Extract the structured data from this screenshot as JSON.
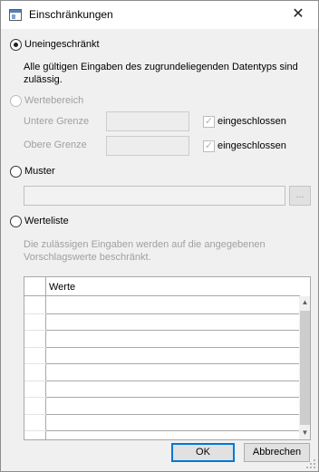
{
  "window": {
    "title": "Einschränkungen",
    "close_glyph": "✕",
    "icon": "window-app-icon"
  },
  "options": {
    "unrestricted": {
      "label": "Uneingeschränkt",
      "selected": true,
      "description": "Alle gültigen Eingaben des zugrundeliegenden Datentyps sind zulässig."
    },
    "range": {
      "label": "Wertebereich",
      "enabled": false,
      "lower_label": "Untere Grenze",
      "lower_value": "",
      "lower_included_label": "eingeschlossen",
      "lower_included": true,
      "upper_label": "Obere Grenze",
      "upper_value": "",
      "upper_included_label": "eingeschlossen",
      "upper_included": true
    },
    "pattern": {
      "label": "Muster",
      "value": "",
      "browse_label": "..."
    },
    "value_list": {
      "label": "Werteliste",
      "description": "Die zulässigen Eingaben werden auf die angegebenen Vorschlagswerte beschränkt.",
      "column_header": "Werte",
      "rows": [
        "",
        "",
        "",
        "",
        "",
        "",
        "",
        "",
        ""
      ]
    }
  },
  "buttons": {
    "ok": "OK",
    "cancel": "Abbrechen"
  }
}
